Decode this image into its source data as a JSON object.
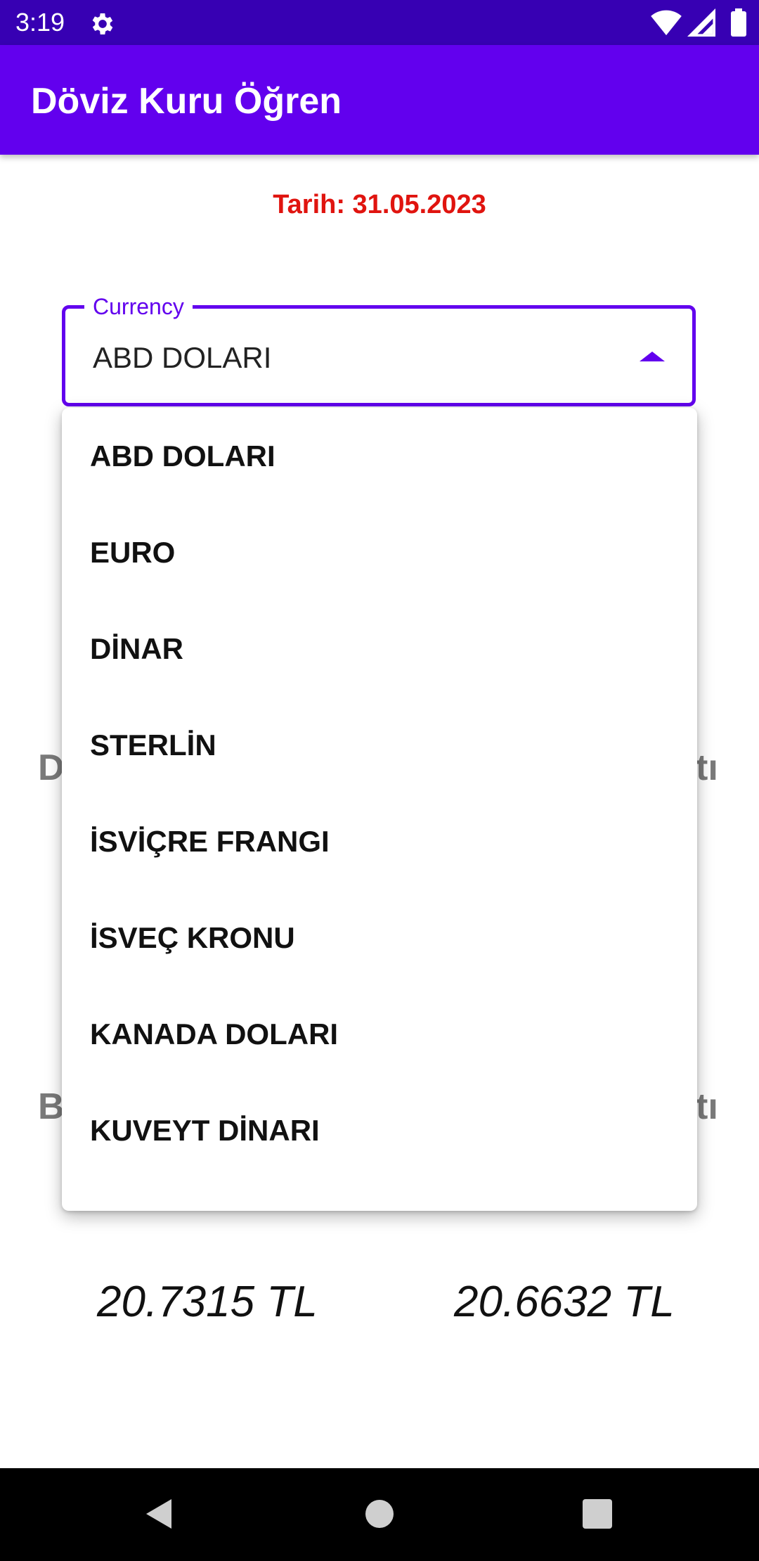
{
  "status_bar": {
    "time": "3:19"
  },
  "app_bar": {
    "title": "Döviz Kuru Öğren"
  },
  "date_text": "Tarih: 31.05.2023",
  "currency_field": {
    "label": "Currency",
    "value": "ABD DOLARI"
  },
  "dropdown": {
    "items": [
      "ABD DOLARI",
      "EURO",
      "DİNAR",
      "STERLİN",
      "İSVİÇRE FRANGI",
      "İSVEÇ KRONU",
      "KANADA DOLARI",
      "KUVEYT DİNARI"
    ]
  },
  "background": {
    "row1_left": "D",
    "row1_right": "tı",
    "row2_left": "B",
    "row2_right": "tı",
    "buy_price": "20.7315 TL",
    "sell_price": "20.6632 TL"
  },
  "colors": {
    "status_bar": "#3700B3",
    "app_bar": "#6200EE",
    "accent": "#6200EE",
    "date_text": "#e0140f"
  },
  "icons": {
    "status_gear": "gear-icon",
    "wifi": "wifi-icon",
    "signal": "signal-icon",
    "battery": "battery-icon",
    "dropdown_arrow": "arrow-up-icon",
    "nav_back": "back-icon",
    "nav_home": "home-icon",
    "nav_recents": "recents-icon"
  }
}
